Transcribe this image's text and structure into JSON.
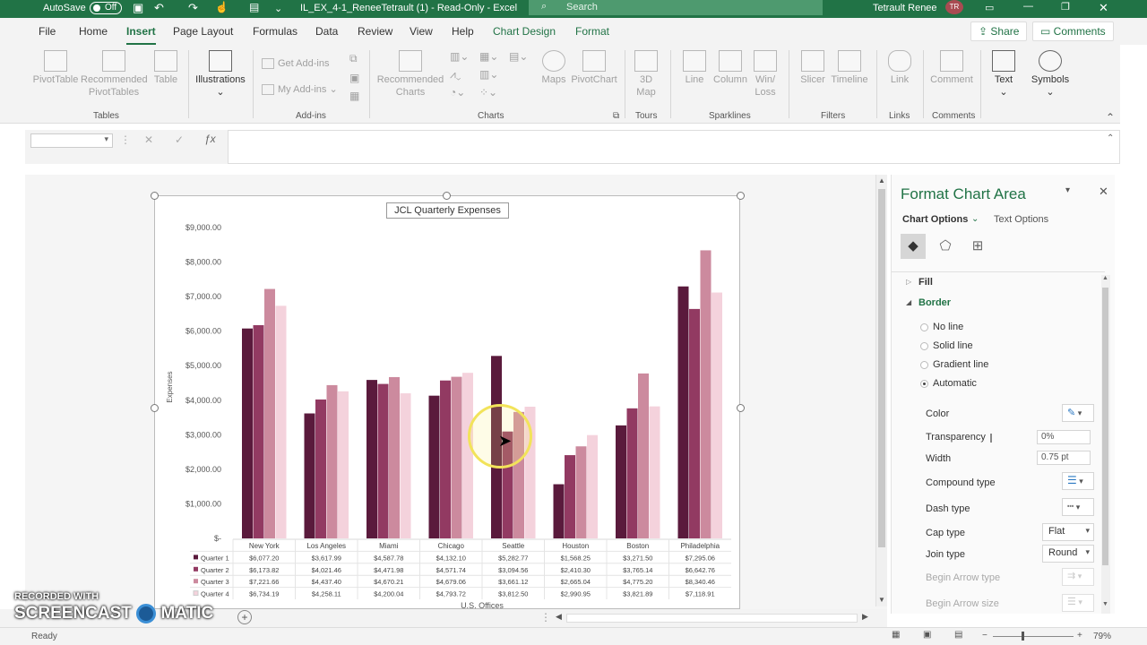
{
  "titlebar": {
    "autosave": "AutoSave",
    "toggle": "Off",
    "filename": "IL_EX_4-1_ReneeTetrault (1)  -  Read-Only  -  Excel",
    "search": "Search",
    "user": "Tetrault Renee",
    "initials": "TR"
  },
  "menu": {
    "tabs": [
      "File",
      "Home",
      "Insert",
      "Page Layout",
      "Formulas",
      "Data",
      "Review",
      "View",
      "Help",
      "Chart Design",
      "Format"
    ],
    "share": "Share",
    "comments": "Comments"
  },
  "ribbon": {
    "pivot": "PivotTable",
    "recpivot": "Recommended PivotTables",
    "table": "Table",
    "illustrations": "Illustrations",
    "getaddins": "Get Add-ins",
    "myaddins": "My Add-ins",
    "recharts": "Recommended Charts",
    "maps": "Maps",
    "pivotchart": "PivotChart",
    "map3d": "3D Map",
    "line": "Line",
    "column": "Column",
    "winloss": "Win/ Loss",
    "slicer": "Slicer",
    "timeline": "Timeline",
    "link": "Link",
    "comment": "Comment",
    "text": "Text",
    "symbols": "Symbols",
    "groups": {
      "tables": "Tables",
      "addins": "Add-ins",
      "charts": "Charts",
      "tours": "Tours",
      "sparklines": "Sparklines",
      "filters": "Filters",
      "links": "Links",
      "comments": "Comments"
    }
  },
  "pane": {
    "title": "Format Chart Area",
    "chart_options": "Chart Options",
    "text_options": "Text Options",
    "fill": "Fill",
    "border": "Border",
    "radios": [
      "No line",
      "Solid line",
      "Gradient line",
      "Automatic"
    ],
    "color": "Color",
    "transparency": "Transparency",
    "transparency_val": "0%",
    "width": "Width",
    "width_val": "0.75 pt",
    "compound": "Compound type",
    "dash": "Dash type",
    "cap": "Cap type",
    "cap_val": "Flat",
    "join": "Join type",
    "join_val": "Round",
    "begin_arrow_type": "Begin Arrow type",
    "begin_arrow_size": "Begin Arrow size"
  },
  "status": {
    "ready": "Ready",
    "zoom": "79%"
  },
  "watermark": {
    "line1": "RECORDED WITH",
    "line2": "SCREENCAST",
    "line3": "MATIC"
  },
  "chart_data": {
    "type": "bar",
    "title": "JCL Quarterly Expenses",
    "xlabel": "U.S. Offices",
    "ylabel": "Expenses",
    "categories": [
      "New York",
      "Los Angeles",
      "Miami",
      "Chicago",
      "Seattle",
      "Houston",
      "Boston",
      "Philadelphia"
    ],
    "ylim": [
      0,
      9000
    ],
    "yticks": [
      "$-",
      "$1,000.00",
      "$2,000.00",
      "$3,000.00",
      "$4,000.00",
      "$5,000.00",
      "$6,000.00",
      "$7,000.00",
      "$8,000.00",
      "$9,000.00"
    ],
    "series": [
      {
        "name": "Quarter 1",
        "color": "#5a1a3c",
        "values": [
          6077.2,
          3617.99,
          4587.78,
          4132.1,
          5282.77,
          1568.25,
          3271.5,
          7295.06
        ],
        "labels": [
          "$6,077.20",
          "$3,617.99",
          "$4,587.78",
          "$4,132.10",
          "$5,282.77",
          "$1,568.25",
          "$3,271.50",
          "$7,295.06"
        ]
      },
      {
        "name": "Quarter 2",
        "color": "#923a62",
        "values": [
          6173.82,
          4021.46,
          4471.98,
          4571.74,
          3094.56,
          2410.3,
          3765.14,
          6642.76
        ],
        "labels": [
          "$6,173.82",
          "$4,021.46",
          "$4,471.98",
          "$4,571.74",
          "$3,094.56",
          "$2,410.30",
          "$3,765.14",
          "$6,642.76"
        ]
      },
      {
        "name": "Quarter 3",
        "color": "#cc8a9e",
        "values": [
          7221.66,
          4437.4,
          4670.21,
          4679.06,
          3661.12,
          2665.04,
          4775.2,
          8340.46
        ],
        "labels": [
          "$7,221.66",
          "$4,437.40",
          "$4,670.21",
          "$4,679.06",
          "$3,661.12",
          "$2,665.04",
          "$4,775.20",
          "$8,340.46"
        ]
      },
      {
        "name": "Quarter 4",
        "color": "#f4d2dc",
        "values": [
          6734.19,
          4258.11,
          4200.04,
          4793.72,
          3812.5,
          2990.95,
          3821.89,
          7118.91
        ],
        "labels": [
          "$6,734.19",
          "$4,258.11",
          "$4,200.04",
          "$4,793.72",
          "$3,812.50",
          "$2,990.95",
          "$3,821.89",
          "$7,118.91"
        ]
      }
    ]
  }
}
